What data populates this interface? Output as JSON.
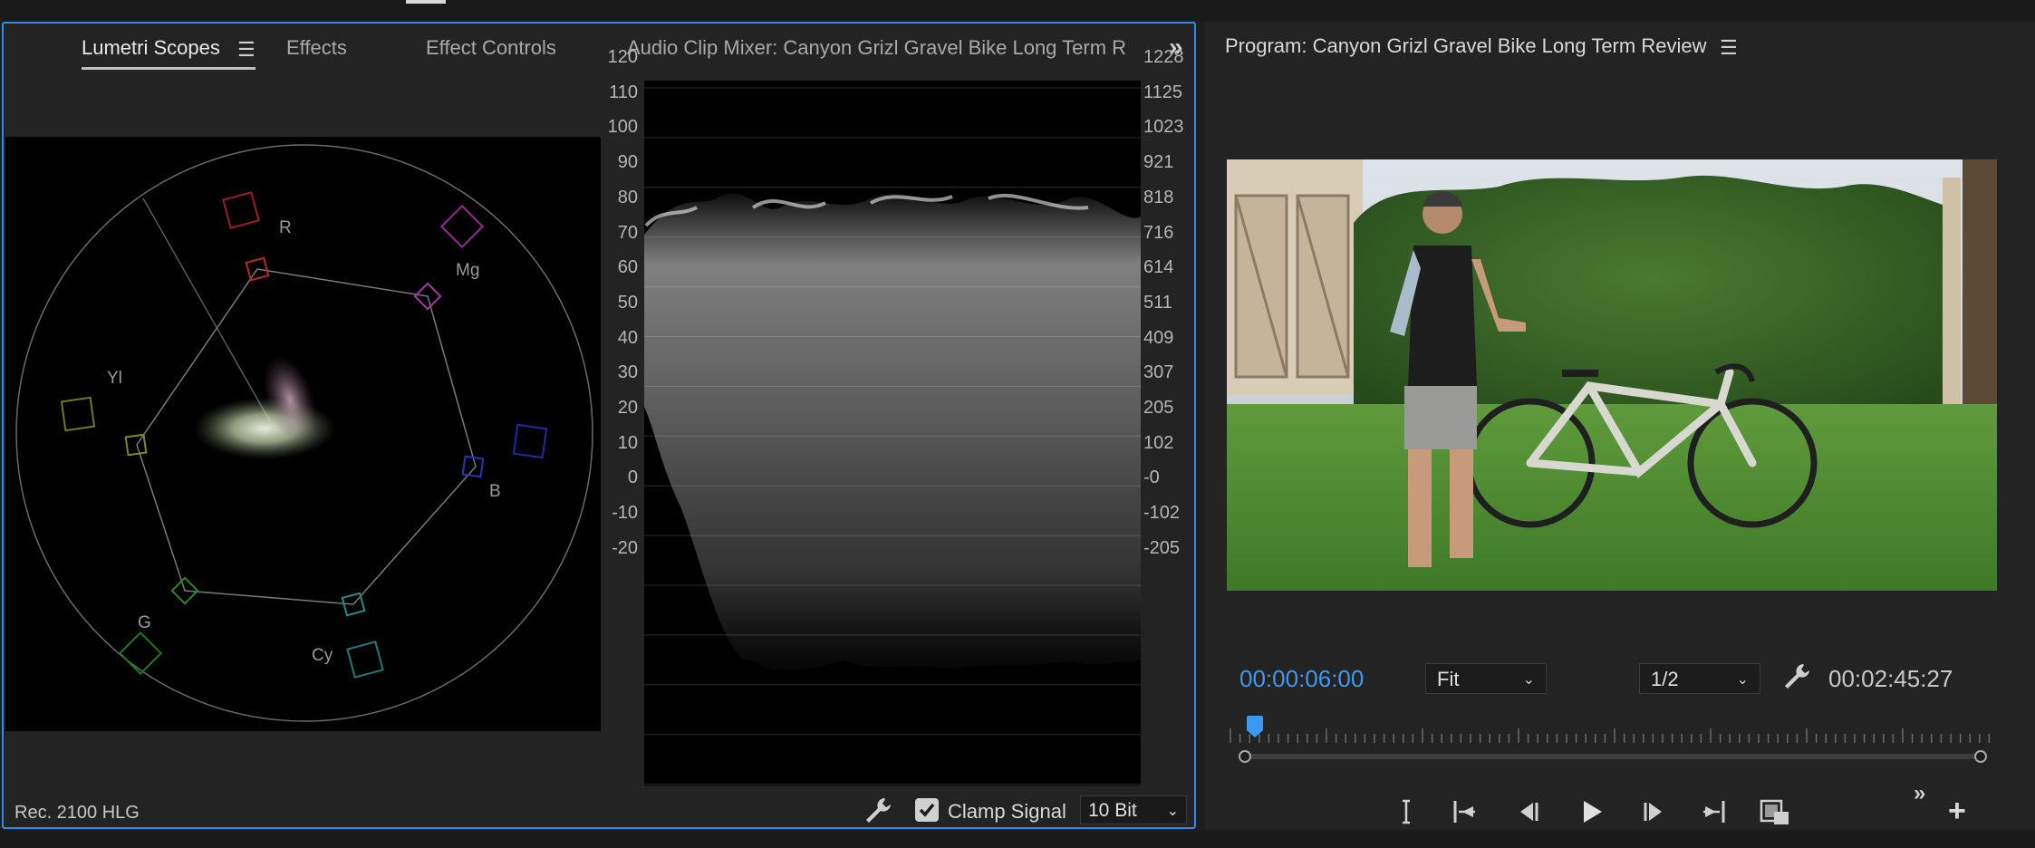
{
  "left_panel": {
    "tabs": [
      {
        "label": "Lumetri Scopes",
        "active": true
      },
      {
        "label": "Effects",
        "active": false
      },
      {
        "label": "Effect Controls",
        "active": false
      },
      {
        "label": "Audio Clip Mixer: Canyon Grizl Gravel Bike Long Term Re",
        "active": false
      }
    ],
    "menu_icon": "hamburger-menu-icon",
    "overflow_icon": "double-chevron-right-icon",
    "vectorscope": {
      "labels": {
        "r": "R",
        "mg": "Mg",
        "yl": "Yl",
        "b": "B",
        "g": "G",
        "cy": "Cy"
      }
    },
    "waveform": {
      "left_scale": [
        "120",
        "110",
        "100",
        "90",
        "80",
        "70",
        "60",
        "50",
        "40",
        "30",
        "20",
        "10",
        "0",
        "-10",
        "-20"
      ],
      "right_scale": [
        "1228",
        "1125",
        "1023",
        "921",
        "818",
        "716",
        "614",
        "511",
        "409",
        "307",
        "205",
        "102",
        "-0",
        "-102",
        "-205"
      ]
    },
    "footer": {
      "colorspace": "Rec. 2100 HLG",
      "clamp_label": "Clamp Signal",
      "clamp_checked": true,
      "bit_depth": "10 Bit",
      "wrench_icon": "wrench-icon"
    }
  },
  "program_monitor": {
    "title": "Program: Canyon Grizl Gravel Bike Long Term Review",
    "menu_icon": "hamburger-menu-icon",
    "timecode": "00:00:06:00",
    "zoom": "Fit",
    "resolution": "1/2",
    "duration": "00:02:45:27",
    "accent_color": "#3d98f2",
    "controls": [
      "mark-in-icon",
      "go-to-in-icon",
      "step-back-icon",
      "play-icon",
      "step-forward-icon",
      "go-to-out-icon",
      "export-frame-icon"
    ]
  }
}
